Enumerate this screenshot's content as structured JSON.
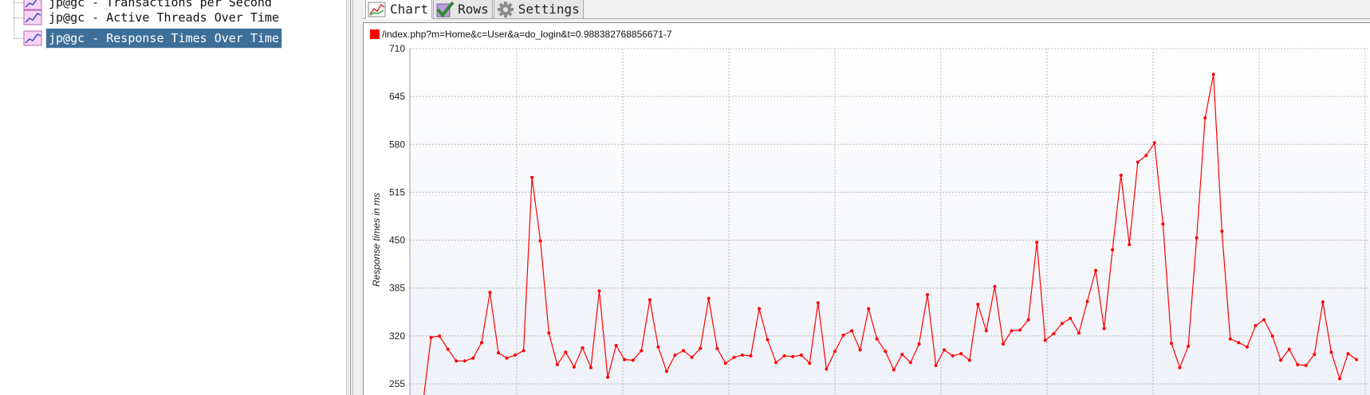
{
  "tree": {
    "items": [
      {
        "label": "jp@gc - Transactions per Second",
        "selected": false
      },
      {
        "label": "jp@gc - Active Threads Over Time",
        "selected": false
      },
      {
        "label": "jp@gc - Response Times Over Time",
        "selected": true
      }
    ]
  },
  "tabs": [
    {
      "label": "Chart",
      "icon": "chart-icon",
      "active": true
    },
    {
      "label": "Rows",
      "icon": "checkmark-icon",
      "active": false
    },
    {
      "label": "Settings",
      "icon": "gear-icon",
      "active": false
    }
  ],
  "colors": {
    "series": "#ff0000",
    "selection": "#3d6f99",
    "plot_background_top": "#ffffff",
    "plot_background_bottom": "#eef1f8",
    "grid": "#b8b8b8"
  },
  "chart_data": {
    "type": "line",
    "title": "",
    "ylabel": "Response times in ms",
    "xlabel": "",
    "ylim": [
      255,
      710
    ],
    "yticks": [
      710,
      645,
      580,
      515,
      450,
      385,
      320,
      255
    ],
    "grid": true,
    "legend_position": "top-left",
    "series": [
      {
        "name": "/index.php?m=Home&c=User&a=do_login&t=0.988382768856671-7",
        "values": [
          225,
          318,
          320,
          302,
          286,
          286,
          290,
          311,
          379,
          297,
          290,
          294,
          300,
          535,
          449,
          324,
          281,
          298,
          278,
          304,
          277,
          381,
          264,
          307,
          288,
          287,
          300,
          369,
          305,
          272,
          294,
          300,
          291,
          303,
          371,
          303,
          283,
          291,
          294,
          293,
          357,
          315,
          284,
          293,
          292,
          294,
          283,
          365,
          275,
          299,
          321,
          327,
          301,
          357,
          316,
          299,
          274,
          295,
          284,
          309,
          376,
          280,
          301,
          293,
          296,
          287,
          363,
          327,
          387,
          309,
          327,
          328,
          342,
          447,
          314,
          323,
          337,
          344,
          324,
          367,
          409,
          330,
          437,
          538,
          444,
          556,
          565,
          582,
          472,
          310,
          277,
          306,
          453,
          616,
          675,
          462,
          316,
          311,
          305,
          334,
          342,
          320,
          287,
          302,
          281,
          280,
          295,
          366,
          298,
          262,
          296,
          288
        ]
      }
    ]
  }
}
